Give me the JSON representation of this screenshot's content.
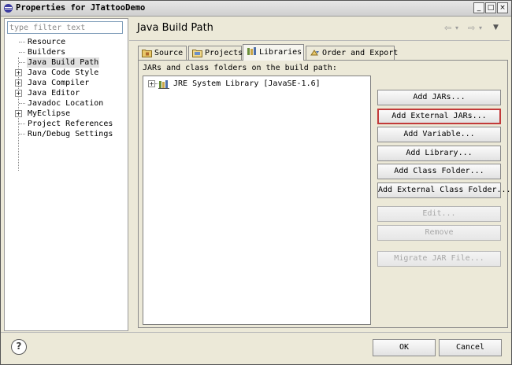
{
  "window": {
    "title": "Properties for JTattooDemo",
    "minimize": "_",
    "maximize": "□",
    "close": "×"
  },
  "filter": {
    "placeholder": "type filter text"
  },
  "tree": [
    {
      "label": "Resource",
      "expandable": false,
      "selected": false
    },
    {
      "label": "Builders",
      "expandable": false,
      "selected": false
    },
    {
      "label": "Java Build Path",
      "expandable": false,
      "selected": true
    },
    {
      "label": "Java Code Style",
      "expandable": true,
      "selected": false
    },
    {
      "label": "Java Compiler",
      "expandable": true,
      "selected": false
    },
    {
      "label": "Java Editor",
      "expandable": true,
      "selected": false
    },
    {
      "label": "Javadoc Location",
      "expandable": false,
      "selected": false
    },
    {
      "label": "MyEclipse",
      "expandable": true,
      "selected": false
    },
    {
      "label": "Project References",
      "expandable": false,
      "selected": false
    },
    {
      "label": "Run/Debug Settings",
      "expandable": false,
      "selected": false
    }
  ],
  "page": {
    "title": "Java Build Path",
    "nav": {
      "back": "⇦",
      "back_menu": "▾",
      "forward": "⇨",
      "forward_menu": "▾",
      "menu": "▼"
    }
  },
  "tabs": [
    {
      "label": "Source",
      "icon": "source-folder-icon",
      "active": false
    },
    {
      "label": "Projects",
      "icon": "projects-icon",
      "active": false
    },
    {
      "label": "Libraries",
      "icon": "libraries-icon",
      "active": true
    },
    {
      "label": "Order and Export",
      "icon": "order-export-icon",
      "active": false
    }
  ],
  "libraries": {
    "label": "JARs and class folders on the build path:",
    "items": [
      {
        "label": "JRE System Library [JavaSE-1.6]",
        "icon": "library-icon",
        "expander": "+"
      }
    ]
  },
  "buttons": {
    "add_jars": "Add JARs...",
    "add_external_jars": "Add External JARs...",
    "add_variable": "Add Variable...",
    "add_library": "Add Library...",
    "add_class_folder": "Add Class Folder...",
    "add_external_class_folder": "Add External Class Folder...",
    "edit": "Edit...",
    "remove": "Remove",
    "migrate_jar": "Migrate JAR File..."
  },
  "footer": {
    "help": "?",
    "ok": "OK",
    "cancel": "Cancel"
  },
  "colors": {
    "focus_border": "#c23a3a",
    "disabled_text": "#a8a8a8"
  }
}
